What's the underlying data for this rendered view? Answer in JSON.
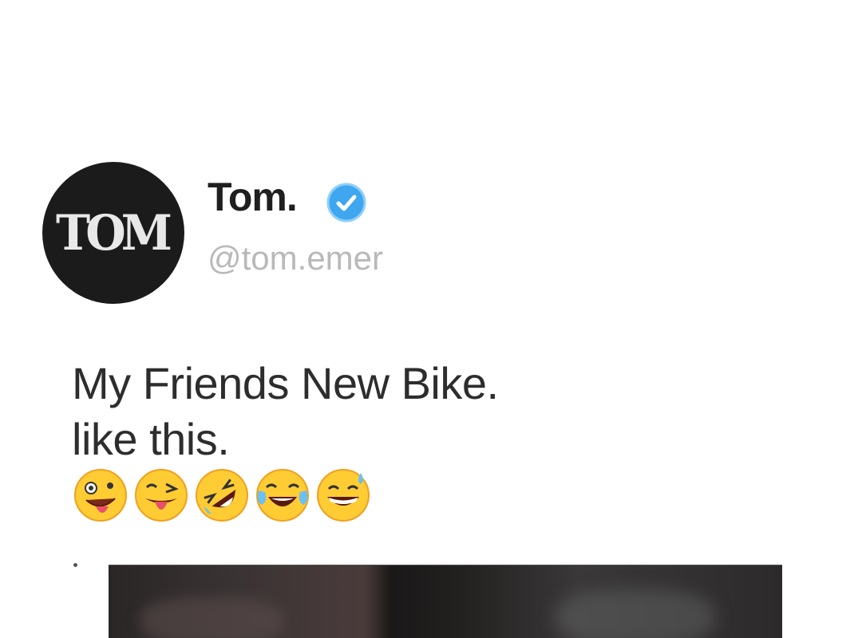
{
  "tweet": {
    "author": {
      "avatar_text": "TOM",
      "display_name": "Tom.",
      "handle": "@tom.emer",
      "verified": true
    },
    "text_lines": [
      "My Friends New Bike.",
      "like this."
    ],
    "emojis": [
      "zany-face",
      "winking-tongue-face",
      "rolling-on-floor-laughing",
      "tears-of-joy",
      "grinning-sweat"
    ]
  },
  "colors": {
    "verified": "#3fa6f0",
    "avatar_bg": "#1b1b1b",
    "handle": "#b9b9b9"
  }
}
